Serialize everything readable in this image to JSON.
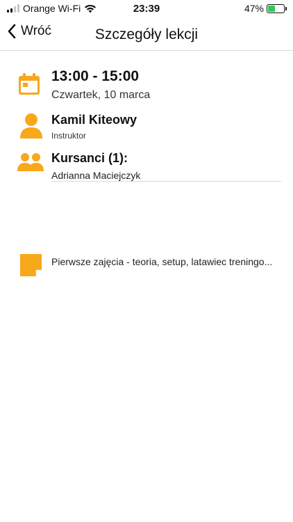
{
  "status_bar": {
    "carrier": "Orange Wi-Fi",
    "time": "23:39",
    "battery": "47%"
  },
  "nav": {
    "back_label": "Wróć",
    "title": "Szczegóły lekcji"
  },
  "lesson": {
    "time_range": "13:00 - 15:00",
    "date": "Czwartek, 10 marca"
  },
  "instructor": {
    "name": "Kamil Kiteowy",
    "role": "Instruktor"
  },
  "students": {
    "title": "Kursanci (1):",
    "items": [
      "Adrianna Maciejczyk"
    ]
  },
  "note": {
    "text": "Pierwsze zajęcia - teoria, setup, latawiec treningo..."
  },
  "colors": {
    "accent": "#f7a81b",
    "battery": "#34c759"
  },
  "icons": {
    "calendar": "calendar-icon",
    "person": "person-icon",
    "group": "group-icon",
    "note": "note-icon"
  }
}
